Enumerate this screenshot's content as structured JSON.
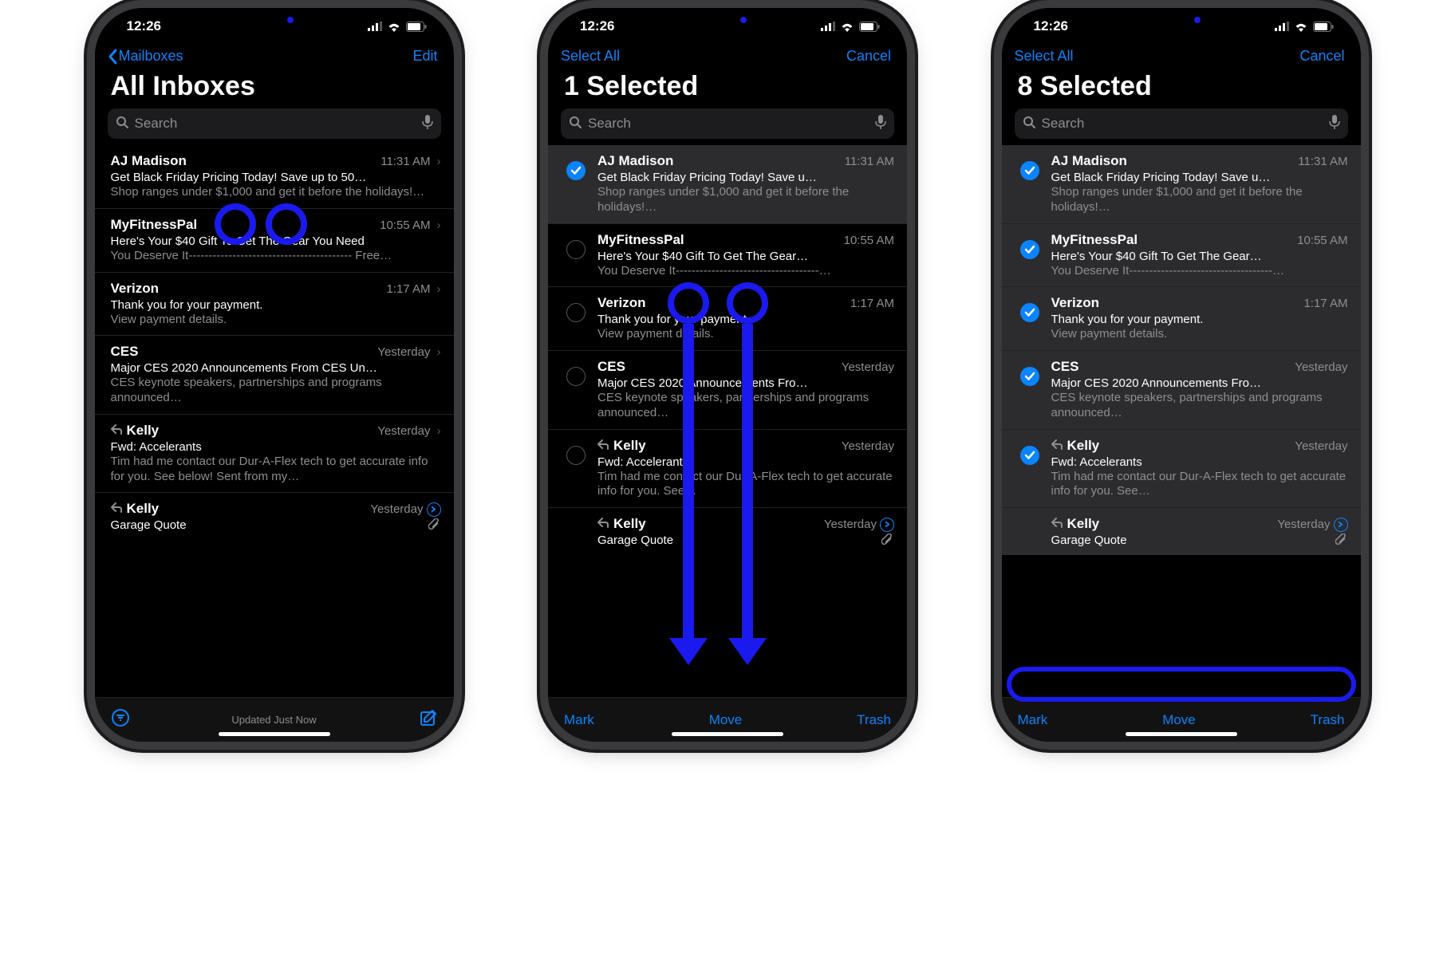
{
  "status": {
    "time": "12:26"
  },
  "accent": "#0a84ff",
  "s1": {
    "nav_back": "Mailboxes",
    "nav_right": "Edit",
    "title": "All Inboxes",
    "search_placeholder": "Search",
    "bottom_status": "Updated Just Now"
  },
  "s2": {
    "nav_left": "Select All",
    "nav_right": "Cancel",
    "title": "1 Selected",
    "search_placeholder": "Search",
    "bottom": {
      "mark": "Mark",
      "move": "Move",
      "trash": "Trash"
    }
  },
  "s3": {
    "nav_left": "Select All",
    "nav_right": "Cancel",
    "title": "8 Selected",
    "search_placeholder": "Search",
    "bottom": {
      "mark": "Mark",
      "move": "Move",
      "trash": "Trash"
    }
  },
  "emails": [
    {
      "sender": "AJ Madison",
      "time": "11:31 AM",
      "subj_s1": "Get Black Friday Pricing Today! Save up to 50…",
      "subj_sel": "Get Black Friday Pricing Today! Save u…",
      "snip_s1": "Shop ranges under $1,000 and get it before the holidays!…",
      "snip_sel": "Shop ranges under $1,000 and get it before the holidays!…"
    },
    {
      "sender": "MyFitnessPal",
      "time": "10:55 AM",
      "subj_s1": "Here's Your $40 Gift To Get The Gear You Need",
      "subj_sel": "Here's Your $40 Gift To Get The Gear…",
      "snip_s1": "You Deserve It----------------------------------------- Free…",
      "snip_sel": "You Deserve It------------------------------------…"
    },
    {
      "sender": "Verizon",
      "time": "1:17 AM",
      "subj_s1": "Thank you for your payment.",
      "subj_sel": "Thank you for your payment.",
      "snip_s1": "View payment details.",
      "snip_sel": "View payment details."
    },
    {
      "sender": "CES",
      "time": "Yesterday",
      "subj_s1": "Major CES 2020 Announcements From CES Un…",
      "subj_sel": "Major CES 2020 Announcements Fro…",
      "snip_s1": "CES keynote speakers, partnerships and programs announced…",
      "snip_sel": "CES keynote speakers, partnerships and programs announced…"
    },
    {
      "sender": "Kelly",
      "time": "Yesterday",
      "reply": true,
      "subj_s1": "Fwd: Accelerants",
      "subj_sel": "Fwd: Accelerants",
      "snip_s1": "Tim had me contact our Dur-A-Flex tech to get accurate info for you. See below! Sent from my…",
      "snip_sel": "Tim had me contact our Dur-A-Flex tech to get accurate info for you. See…"
    },
    {
      "sender": "Kelly",
      "time": "Yesterday",
      "reply": true,
      "thread": true,
      "clip": true,
      "subj_s1": "Garage Quote",
      "subj_sel": "Garage Quote",
      "snip_s1": "",
      "snip_sel": ""
    }
  ]
}
